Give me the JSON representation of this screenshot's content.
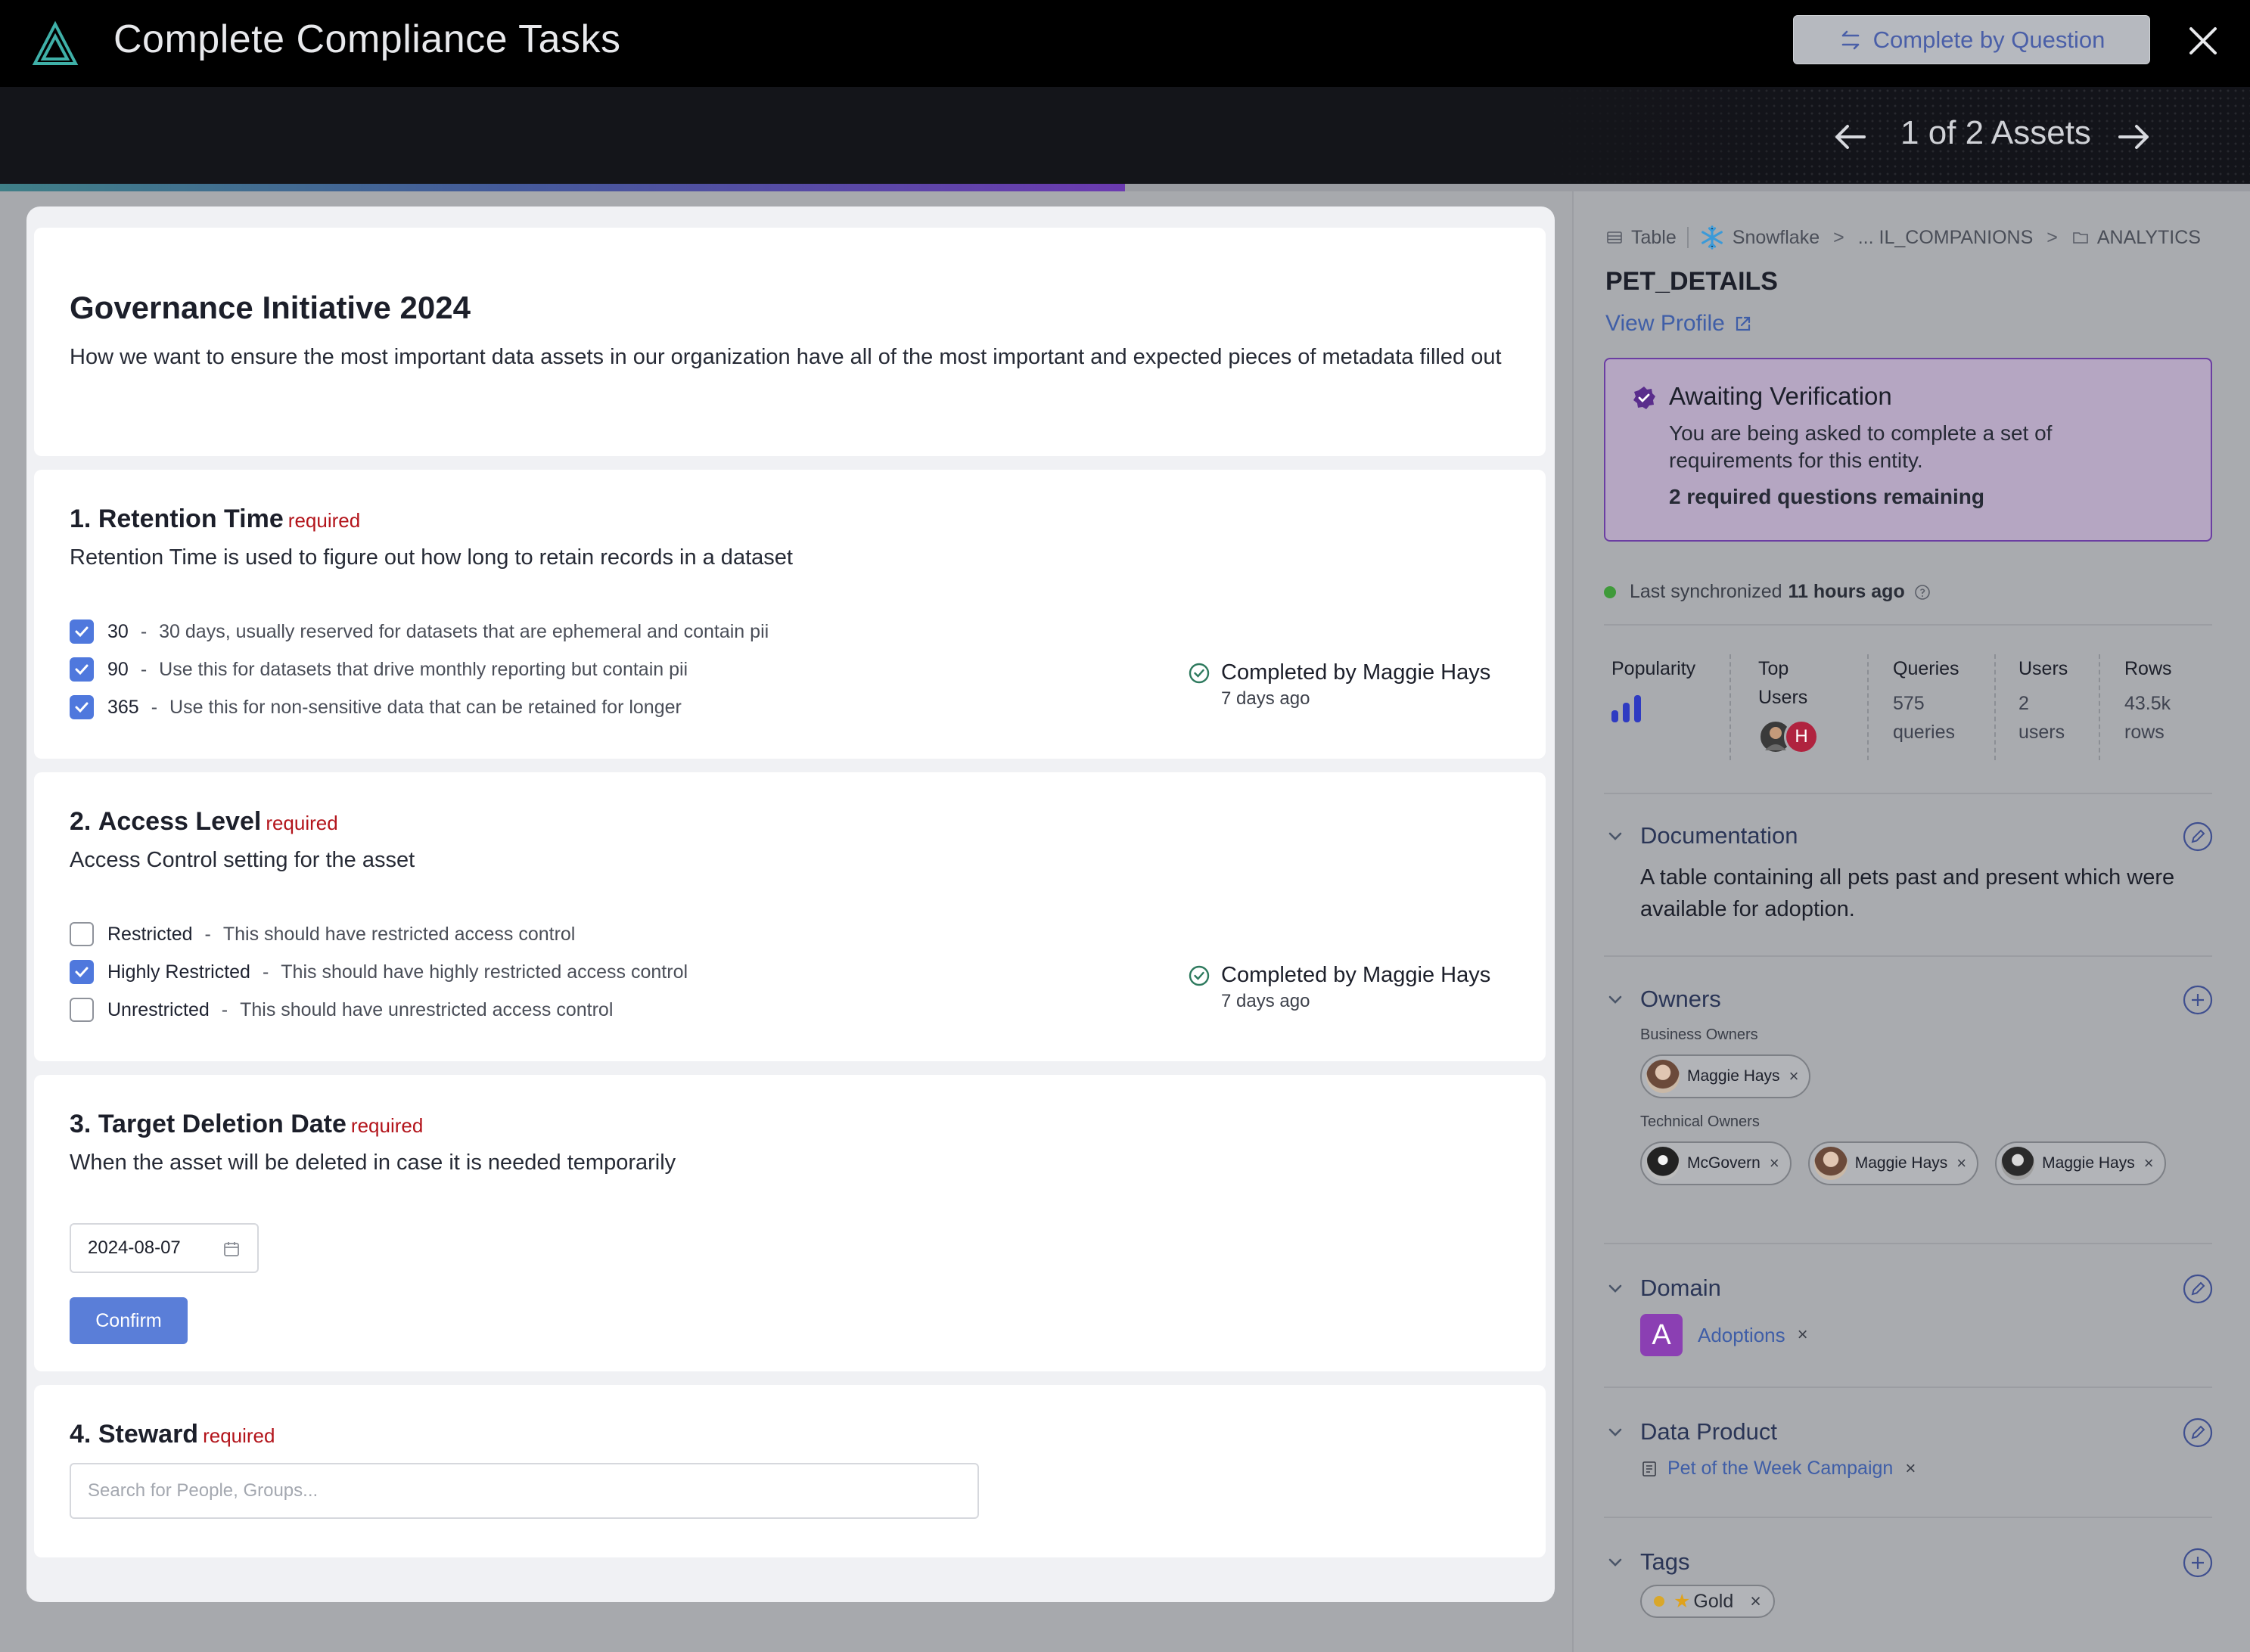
{
  "header": {
    "title": "Complete Compliance Tasks",
    "complete_by_question_label": "Complete by Question",
    "asset_nav": "1 of 2 Assets",
    "progress_fraction": 0.5
  },
  "initiative": {
    "title": "Governance Initiative 2024",
    "description": "How we want to ensure the most important data assets in our organization have all of the most important and expected pieces of metadata filled out"
  },
  "required_label": "required",
  "questions": [
    {
      "number": "1.",
      "title": "Retention Time",
      "description": "Retention Time is used to figure out how long to retain records in a dataset",
      "options": [
        {
          "label": "30",
          "description": "30 days, usually reserved for datasets that are ephemeral and contain pii",
          "checked": true
        },
        {
          "label": "90",
          "description": "Use this for datasets that drive monthly reporting but contain pii",
          "checked": true
        },
        {
          "label": "365",
          "description": "Use this for non-sensitive data that can be retained for longer",
          "checked": true
        }
      ],
      "completed_by": "Completed by Maggie Hays",
      "completed_when": "7 days ago"
    },
    {
      "number": "2.",
      "title": "Access Level",
      "description": "Access Control setting for the asset",
      "options": [
        {
          "label": "Restricted",
          "description": "This should have restricted access control",
          "checked": false
        },
        {
          "label": "Highly Restricted",
          "description": "This should have highly restricted access control",
          "checked": true
        },
        {
          "label": "Unrestricted",
          "description": "This should have unrestricted access control",
          "checked": false
        }
      ],
      "completed_by": "Completed by Maggie Hays",
      "completed_when": "7 days ago"
    },
    {
      "number": "3.",
      "title": "Target Deletion Date",
      "description": "When the asset will be deleted in case it is needed temporarily",
      "date_value": "2024-08-07",
      "confirm_label": "Confirm"
    },
    {
      "number": "4.",
      "title": "Steward",
      "search_placeholder": "Search for People, Groups..."
    }
  ],
  "asset": {
    "breadcrumb": {
      "type": "Table",
      "platform": "Snowflake",
      "path1": "... IL_COMPANIONS",
      "path2": "ANALYTICS"
    },
    "name": "PET_DETAILS",
    "view_profile": "View Profile",
    "verification": {
      "title": "Awaiting Verification",
      "description": "You are being asked to complete a set of requirements for this entity.",
      "remaining": "2 required questions remaining"
    },
    "sync": {
      "label": "Last synchronized",
      "value": "11 hours ago"
    },
    "stats": {
      "popularity_label": "Popularity",
      "top_users_label": "Top Users",
      "top_users_initial": "H",
      "queries_label": "Queries",
      "queries_value": "575 queries",
      "users_label": "Users",
      "users_value": "2 users",
      "rows_label": "Rows",
      "rows_value": "43.5k rows"
    },
    "documentation": {
      "title": "Documentation",
      "text": "A table containing all pets past and present which were available for adoption."
    },
    "owners": {
      "title": "Owners",
      "business_label": "Business Owners",
      "business": [
        "Maggie Hays"
      ],
      "technical_label": "Technical Owners",
      "technical": [
        "McGovern",
        "Maggie Hays",
        "Maggie Hays"
      ]
    },
    "domain": {
      "title": "Domain",
      "badge": "A",
      "name": "Adoptions"
    },
    "data_product": {
      "title": "Data Product",
      "name": "Pet of the Week Campaign"
    },
    "tags": {
      "title": "Tags",
      "items": [
        "Gold"
      ]
    }
  },
  "colors": {
    "accent": "#4f78dd",
    "verify_border": "#6b3ea2",
    "required": "#b3141b",
    "domain_badge": "#8b3fb3"
  }
}
